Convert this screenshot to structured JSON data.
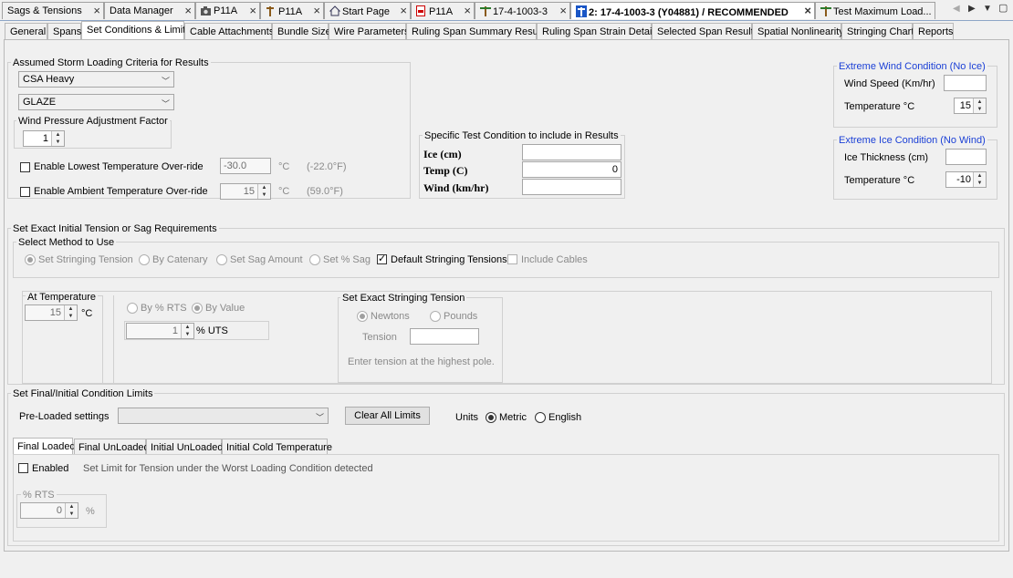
{
  "doc_tabs": [
    {
      "label": "Sags & Tensions",
      "icon": "none"
    },
    {
      "label": "Data Manager",
      "icon": "none"
    },
    {
      "label": "P11A",
      "icon": "camera-icon"
    },
    {
      "label": "P11A",
      "icon": "pole-icon"
    },
    {
      "label": "Start Page",
      "icon": "house-icon"
    },
    {
      "label": "P11A",
      "icon": "pdf-icon"
    },
    {
      "label": "17-4-1003-3",
      "icon": "structure-icon"
    },
    {
      "label": "2: 17-4-1003-3 (Y04881) / RECOMMENDED",
      "icon": "blue-structure-icon"
    },
    {
      "label": "Test Maximum Load...",
      "icon": "structure-icon"
    }
  ],
  "sub_tabs": [
    "General",
    "Spans",
    "Set Conditions & Limits",
    "Cable Attachments",
    "Bundle Size",
    "Wire Parameters",
    "Ruling Span Summary Results",
    "Ruling Span Strain Details",
    "Selected Span Results",
    "Spatial Nonlinearity",
    "Stringing Chart",
    "Reports"
  ],
  "storm": {
    "title": "Assumed Storm Loading Criteria for Results",
    "loading_select": "CSA Heavy",
    "ice_select": "GLAZE",
    "wind_factor_title": "Wind Pressure Adjustment Factor",
    "wind_factor_value": "1",
    "lowest_temp_label": "Enable Lowest Temperature Over-ride",
    "lowest_temp_value": "-30.0",
    "lowest_temp_unit": "°C",
    "lowest_temp_f": "(-22.0°F)",
    "ambient_label": "Enable Ambient Temperature Over-ride",
    "ambient_value": "15",
    "ambient_unit": "°C",
    "ambient_f": "(59.0°F)"
  },
  "specific": {
    "title": "Specific Test Condition to include in Results",
    "ice_label": "Ice (cm)",
    "ice_value": "",
    "temp_label": "Temp (C)",
    "temp_value": "0",
    "wind_label": "Wind (km/hr)",
    "wind_value": ""
  },
  "extreme_wind": {
    "title": "Extreme Wind Condition (No Ice)",
    "speed_label": "Wind Speed (Km/hr)",
    "speed_value": "",
    "temp_label": "Temperature °C",
    "temp_value": "15"
  },
  "extreme_ice": {
    "title": "Extreme Ice Condition (No Wind)",
    "thick_label": "Ice Thickness (cm)",
    "thick_value": "",
    "temp_label": "Temperature °C",
    "temp_value": "-10"
  },
  "initial": {
    "title": "Set Exact Initial Tension or Sag Requirements",
    "method_title": "Select Method to Use",
    "methods": [
      "Set Stringing Tension",
      "By Catenary",
      "Set Sag Amount",
      "Set % Sag"
    ],
    "default_stringing": "Default Stringing Tensions",
    "include_cables": "Include Cables",
    "at_temp_title": "At Temperature",
    "at_temp_value": "15",
    "at_temp_unit": "°C",
    "by_rts": "By % RTS",
    "by_value": "By Value",
    "uts_value": "1",
    "uts_unit": "% UTS",
    "exact_title": "Set Exact Stringing Tension",
    "newtons": "Newtons",
    "pounds": "Pounds",
    "tension_label": "Tension",
    "tension_value": "",
    "hint": "Enter tension at the highest pole."
  },
  "limits": {
    "title": "Set Final/Initial Condition Limits",
    "preloaded_label": "Pre-Loaded settings",
    "preloaded_value": "",
    "clear_button": "Clear All Limits",
    "units_label": "Units",
    "metric": "Metric",
    "english": "English",
    "tabs": [
      "Final Loaded",
      "Final UnLoaded",
      "Initial UnLoaded",
      "Initial Cold Temperature"
    ],
    "enabled_label": "Enabled",
    "enabled_desc": "Set Limit for Tension under the Worst Loading Condition detected",
    "rts_title": "% RTS",
    "rts_value": "0",
    "rts_unit": "%"
  }
}
